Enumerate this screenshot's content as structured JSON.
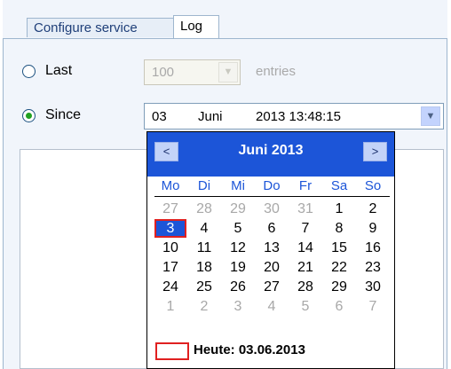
{
  "tabs": [
    {
      "label": "Configure service",
      "active": false
    },
    {
      "label": "Log",
      "active": true
    }
  ],
  "last": {
    "label": "Last",
    "value": "100",
    "suffix": "entries",
    "selected": false
  },
  "since": {
    "label": "Since",
    "selected": true,
    "day": "03",
    "month": "Juni",
    "datetime": "2013 13:48:15"
  },
  "calendar": {
    "title": "Juni 2013",
    "prev": "<",
    "next": ">",
    "weekdays": [
      "Mo",
      "Di",
      "Mi",
      "Do",
      "Fr",
      "Sa",
      "So"
    ],
    "weeks": [
      [
        "27",
        "28",
        "29",
        "30",
        "31",
        "1",
        "2"
      ],
      [
        "3",
        "4",
        "5",
        "6",
        "7",
        "8",
        "9"
      ],
      [
        "10",
        "11",
        "12",
        "13",
        "14",
        "15",
        "16"
      ],
      [
        "17",
        "18",
        "19",
        "20",
        "21",
        "22",
        "23"
      ],
      [
        "24",
        "25",
        "26",
        "27",
        "28",
        "29",
        "30"
      ],
      [
        "1",
        "2",
        "3",
        "4",
        "5",
        "6",
        "7"
      ]
    ],
    "selected_day": "3",
    "today_label": "Heute: 03.06.2013"
  },
  "colors": {
    "header": "#1c55d8",
    "selection_border": "#e02020",
    "radio_dot": "#21a121"
  }
}
